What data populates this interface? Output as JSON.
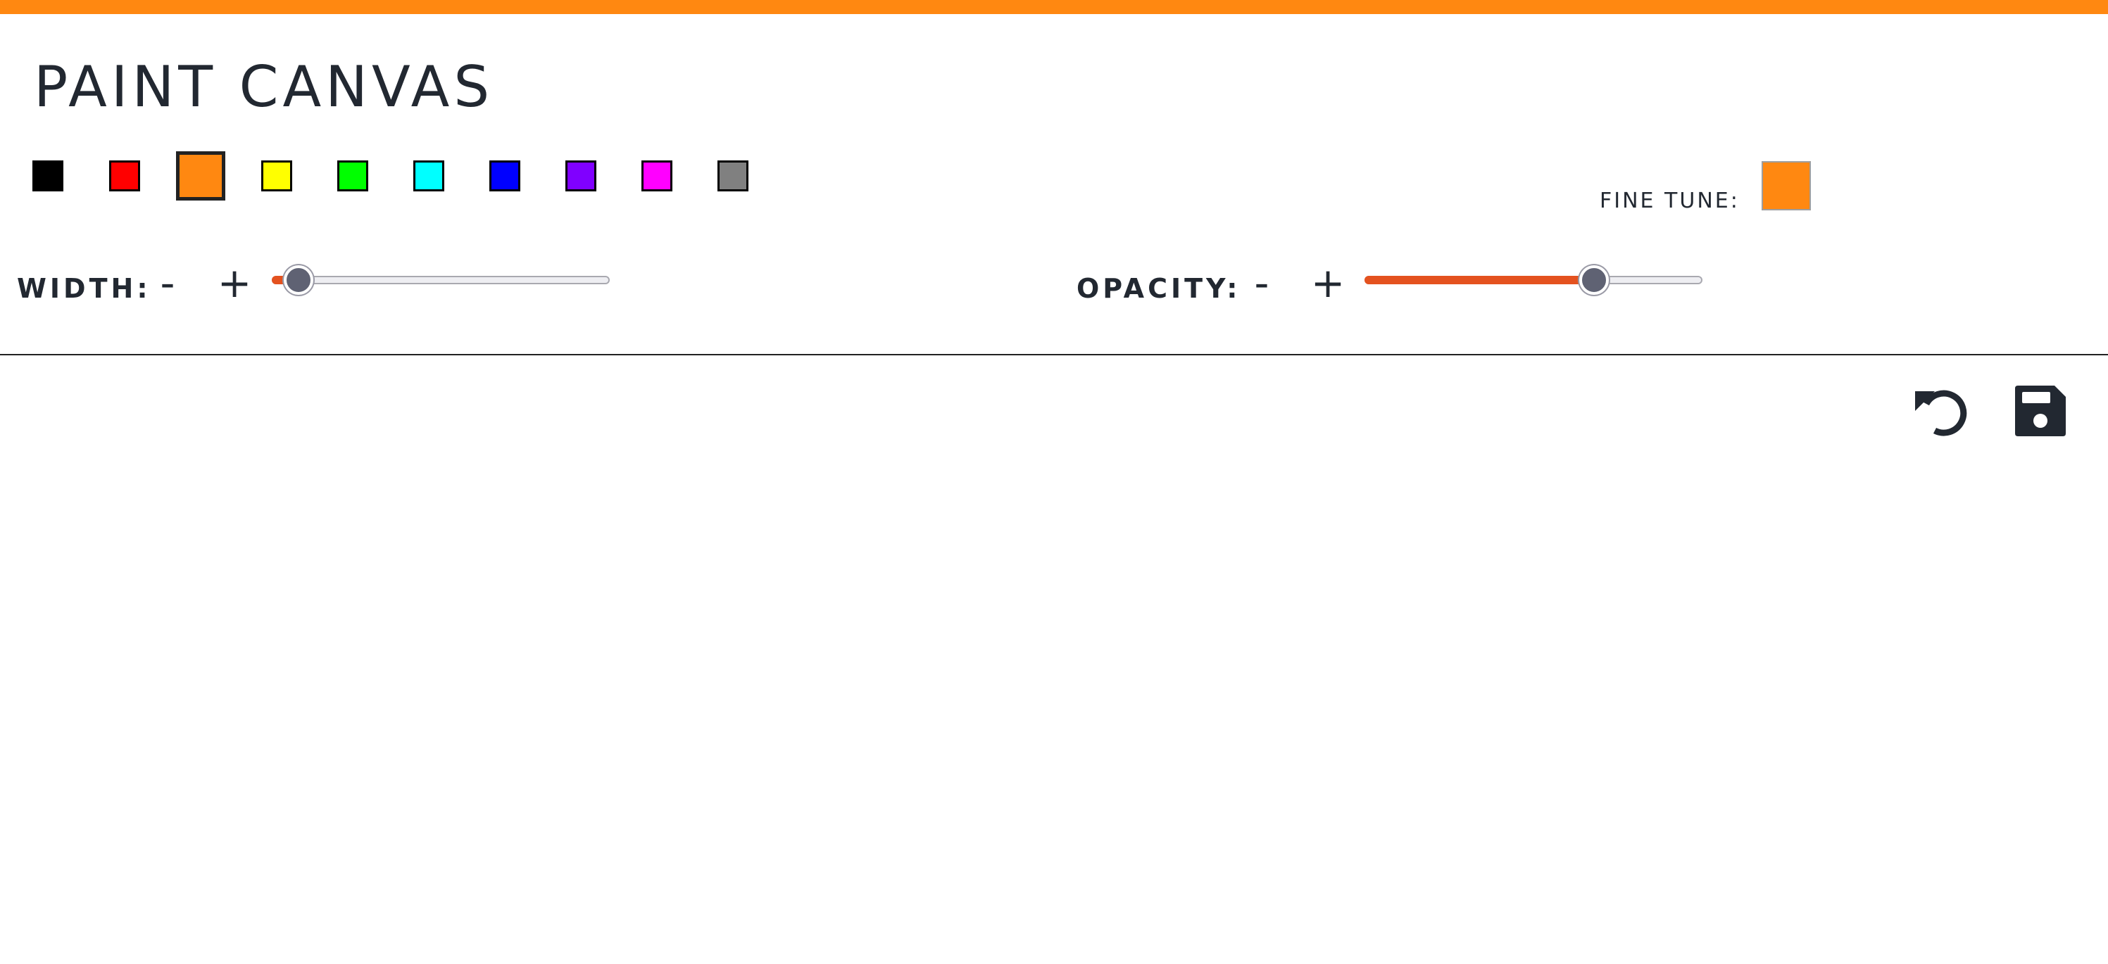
{
  "app": {
    "title": "PAINT CANVAS",
    "accent_color": "#ff8811"
  },
  "palette": {
    "colors": [
      "#000000",
      "#ff0000",
      "#ff8811",
      "#ffff00",
      "#00ff00",
      "#00ffff",
      "#0000ff",
      "#8000ff",
      "#ff00ff",
      "#808080"
    ],
    "selected_color": "#ff8811"
  },
  "fine_tune": {
    "label": "FINE TUNE:",
    "color": "#ff8811"
  },
  "width_control": {
    "label": "WIDTH:",
    "decrement": "-",
    "increment": "+",
    "value_fraction": 0.08,
    "fill_color": "#e4521f"
  },
  "opacity_control": {
    "label": "OPACITY:",
    "decrement": "-",
    "increment": "+",
    "value_fraction": 0.68,
    "fill_color": "#e4521f"
  },
  "toolbar": {
    "undo_icon": "undo-icon",
    "save_icon": "floppy-disk-save-icon"
  }
}
